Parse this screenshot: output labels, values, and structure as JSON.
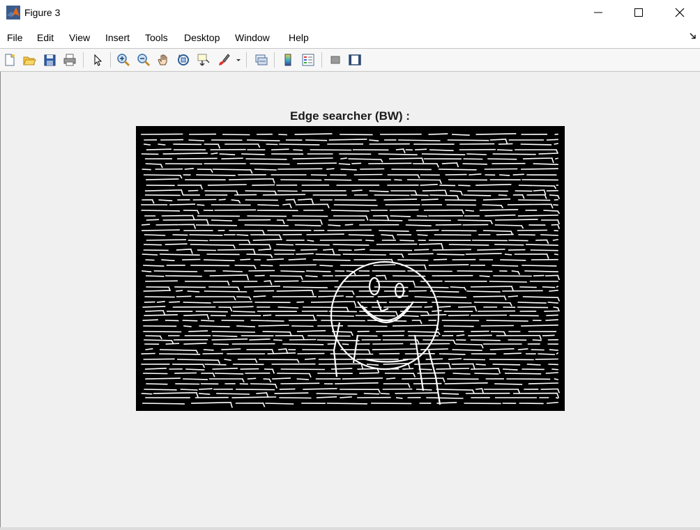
{
  "window": {
    "title": "Figure 3",
    "app_icon": "matlab-icon"
  },
  "menu": {
    "items": [
      {
        "label": "File"
      },
      {
        "label": "Edit"
      },
      {
        "label": "View"
      },
      {
        "label": "Insert"
      },
      {
        "label": "Tools"
      },
      {
        "label": "Desktop"
      },
      {
        "label": "Window"
      },
      {
        "label": "Help"
      }
    ]
  },
  "toolbar": {
    "buttons": [
      "new-figure-icon",
      "open-file-icon",
      "save-icon",
      "print-icon",
      "edit-plot-icon",
      "zoom-in-icon",
      "zoom-out-icon",
      "pan-icon",
      "rotate-3d-icon",
      "data-cursor-icon",
      "brush-icon",
      "link-plot-icon",
      "colorbar-icon",
      "legend-icon",
      "hide-plot-tools-icon",
      "show-plot-tools-icon"
    ]
  },
  "axes": {
    "title": "Edge searcher (BW) :",
    "image_type": "binary edge map, white edges on black"
  },
  "colors": {
    "canvas": "#f0f0f0",
    "image_bg": "#000000",
    "edge": "#ffffff"
  }
}
